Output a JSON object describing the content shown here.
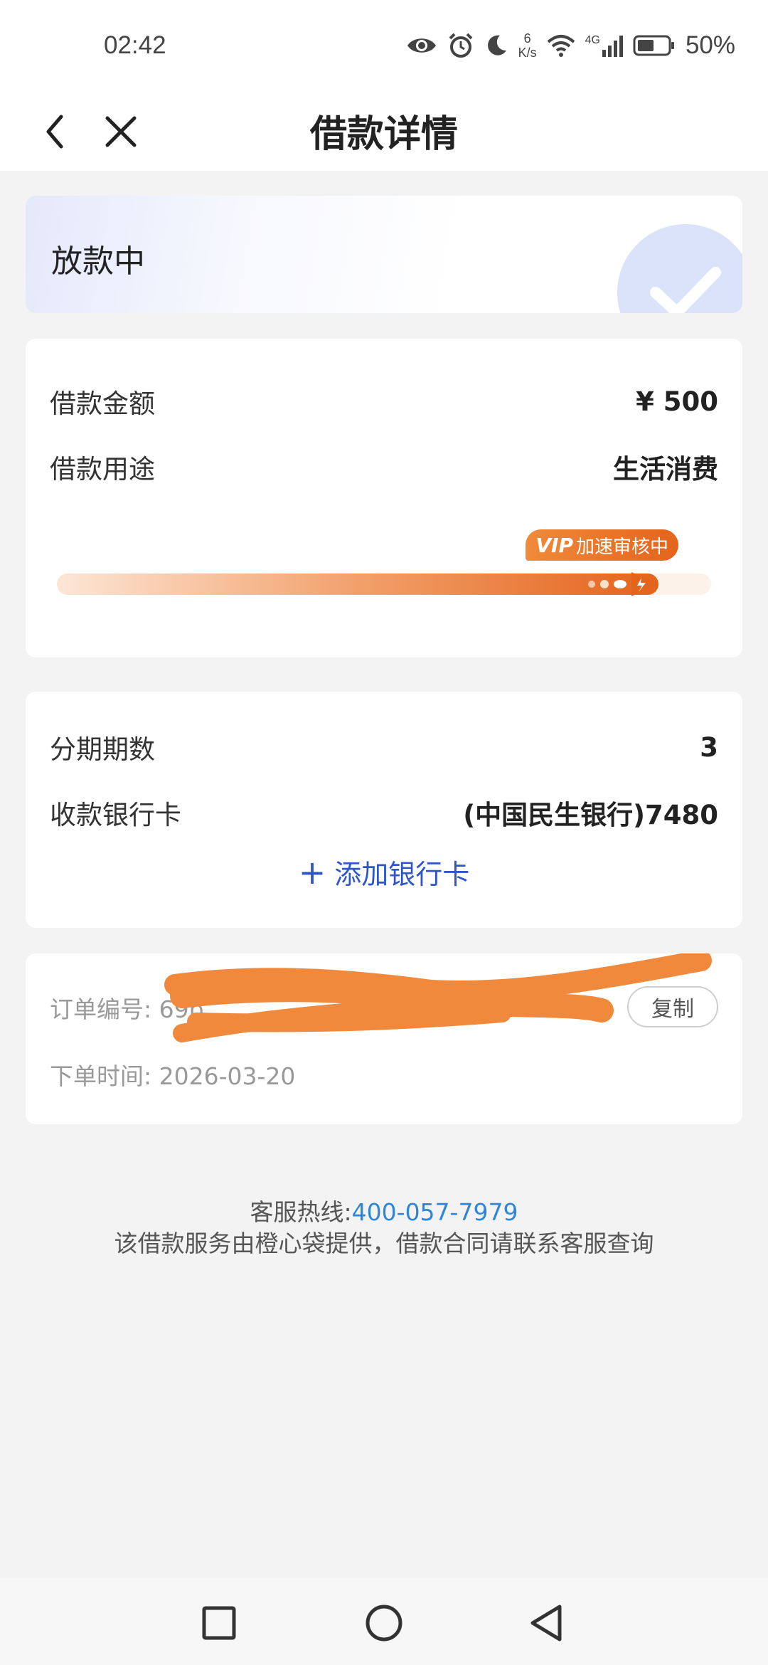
{
  "status_bar": {
    "time": "02:42",
    "net_speed_value": "6",
    "net_speed_unit": "K/s",
    "signal_type": "4G",
    "battery": "50%",
    "icons": [
      "eye-icon",
      "alarm-icon",
      "moon-icon",
      "wifi-icon",
      "signal-icon",
      "battery-icon"
    ]
  },
  "nav": {
    "title": "借款详情",
    "back_icon": "chevron-left-icon",
    "close_icon": "close-icon"
  },
  "loan_status": {
    "text": "放款中",
    "icon": "check-icon"
  },
  "loan_info": {
    "amount_label": "借款金额",
    "amount_value": "¥ 500",
    "purpose_label": "借款用途",
    "purpose_value": "生活消费",
    "vip_badge_vip": "VIP",
    "vip_badge_text": "加速审核中",
    "progress_fraction": 0.92
  },
  "plan": {
    "installments_label": "分期期数",
    "installments_value": "3",
    "bank_card_label": "收款银行卡",
    "bank_card_value": "(中国民生银行)7480",
    "add_card_plus": "+",
    "add_card_label": "添加银行卡"
  },
  "order": {
    "order_no_label": "订单编号:",
    "order_no_visible": "69b",
    "copy_label": "复制",
    "order_time_label": "下单时间:",
    "order_time_value": "2026-03-20"
  },
  "footer": {
    "hotline_label": "客服热线:",
    "hotline_phone": "400-057-7979",
    "note": "该借款服务由橙心袋提供，借款合同请联系客服查询"
  },
  "colors": {
    "accent_blue": "#2f55c8",
    "link_blue": "#2f86d6",
    "progress_orange": "#e4641c",
    "redaction_orange": "#f0893c",
    "background": "#f3f3f3"
  }
}
